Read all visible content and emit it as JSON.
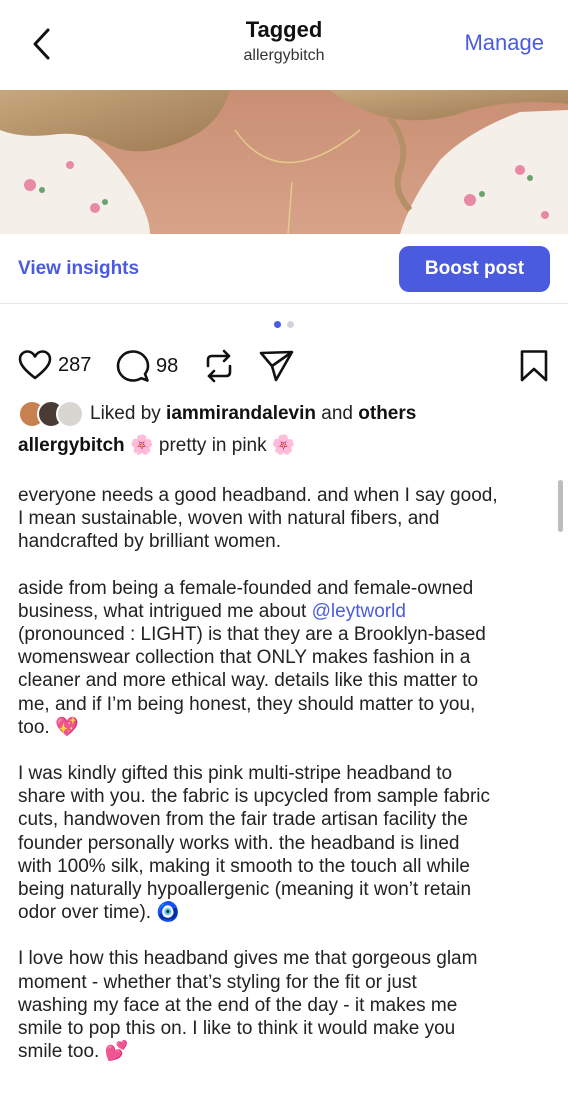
{
  "header": {
    "title": "Tagged",
    "subtitle": "allergybitch",
    "manage_label": "Manage",
    "back_icon": "chevron-left-icon"
  },
  "photo": {
    "alt": "Tagged post photo"
  },
  "insights": {
    "view_label": "View insights",
    "boost_label": "Boost post"
  },
  "carousel": {
    "page_count": 2,
    "active_index": 0
  },
  "actions": {
    "likes": "287",
    "comments": "98",
    "like_icon": "heart-icon",
    "comment_icon": "comment-icon",
    "repost_icon": "repost-icon",
    "share_icon": "send-icon",
    "save_icon": "bookmark-icon"
  },
  "liked_by": {
    "prefix": "Liked by ",
    "user": "iammirandalevin",
    "joiner": " and ",
    "others": "others"
  },
  "caption": {
    "username": "allergybitch",
    "headline_emoji": "🌸",
    "headline_text": "pretty in pink",
    "p1": "everyone needs a good headband. and when I say good,\nI mean sustainable, woven with natural fibers, and\nhandcrafted by brilliant women.",
    "p2_before": "aside from being a female-founded and female-owned\nbusiness, what intrigued me about ",
    "p2_mention": "@leytworld",
    "p2_after": "\n(pronounced : LIGHT) is that they are a Brooklyn-based\nwomenswear collection that ONLY makes fashion in a\ncleaner and more ethical way. details like this matter to\nme, and if I’m being honest, they should matter to you,\ntoo. ",
    "p2_emoji": "💖",
    "p3": "I was kindly gifted this pink multi-stripe headband to\nshare with you. the fabric is upcycled from sample fabric\ncuts, handwoven from the fair trade artisan facility the\nfounder personally works with. the headband is lined\nwith 100% silk, making it smooth to the touch all while\nbeing naturally hypoallergenic (meaning it won’t retain\nodor over time). ",
    "p3_emoji": "🧿",
    "p4": "I love how this headband gives me that gorgeous glam\nmoment - whether that’s styling for the fit or just\nwashing my face at the end of the day - it makes me\nsmile to pop this on. I like to think it would make you\nsmile too. ",
    "p4_emoji": "💕"
  },
  "colors": {
    "accent": "#4a5be0",
    "text": "#111111",
    "divider": "#e6e6e6"
  }
}
